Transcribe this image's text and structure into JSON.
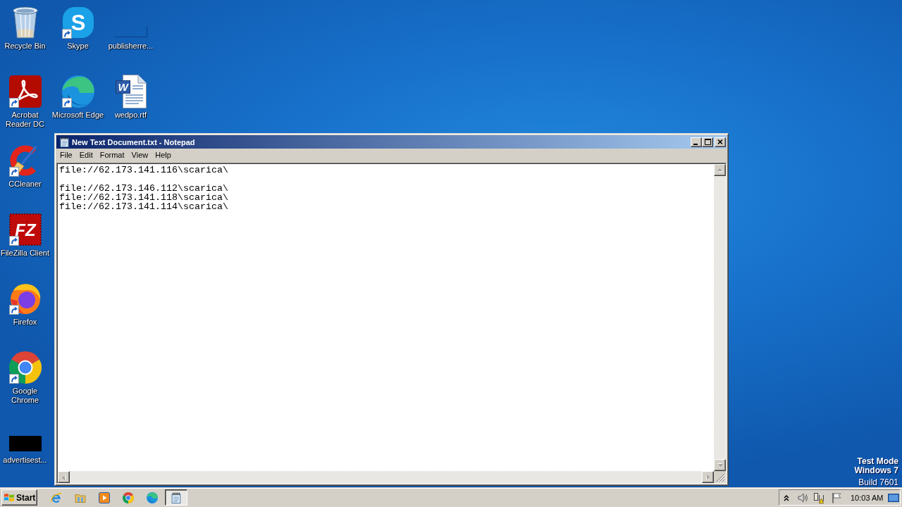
{
  "desktop": {
    "icon_columns": [
      [
        {
          "label": "Recycle Bin",
          "kind": "bin",
          "shortcut": false
        },
        {
          "label": "Acrobat Reader DC",
          "kind": "acrobat",
          "shortcut": true
        },
        {
          "label": "CCleaner",
          "kind": "ccleaner",
          "shortcut": true
        },
        {
          "label": "FileZilla Client",
          "kind": "filezilla",
          "logo_text": "FZ",
          "shortcut": true
        },
        {
          "label": "Firefox",
          "kind": "firefox",
          "shortcut": true
        },
        {
          "label": "Google Chrome",
          "kind": "chrome",
          "shortcut": true
        },
        {
          "label": "advertisest...",
          "kind": "thumbnail",
          "shortcut": false
        }
      ],
      [
        {
          "label": "Skype",
          "kind": "skype",
          "logo_text": "S",
          "shortcut": true
        },
        {
          "label": "Microsoft Edge",
          "kind": "edge",
          "shortcut": true
        }
      ],
      [
        {
          "label": "publisherre...",
          "kind": "blank",
          "shortcut": false
        },
        {
          "label": "wedpo.rtf",
          "kind": "document",
          "logo_text": "W",
          "shortcut": false
        }
      ]
    ],
    "notice": [
      {
        "text": "Test Mode",
        "bold": true
      },
      {
        "text": "Windows 7",
        "bold": true
      },
      {
        "text": "Build 7601",
        "bold": false
      }
    ]
  },
  "notepad": {
    "title": "New Text Document.txt - Notepad",
    "active": true,
    "menu": [
      "File",
      "Edit",
      "Format",
      "View",
      "Help"
    ],
    "text": "file://62.173.141.116\\scarica\\\n\nfile://62.173.146.112\\scarica\\\nfile://62.173.141.118\\scarica\\\nfile://62.173.141.114\\scarica\\",
    "scrollbars_disabled": true
  },
  "taskbar": {
    "start_label": "Start",
    "task_buttons": [
      {
        "selected": true
      }
    ],
    "clock": "10:03 AM"
  }
}
